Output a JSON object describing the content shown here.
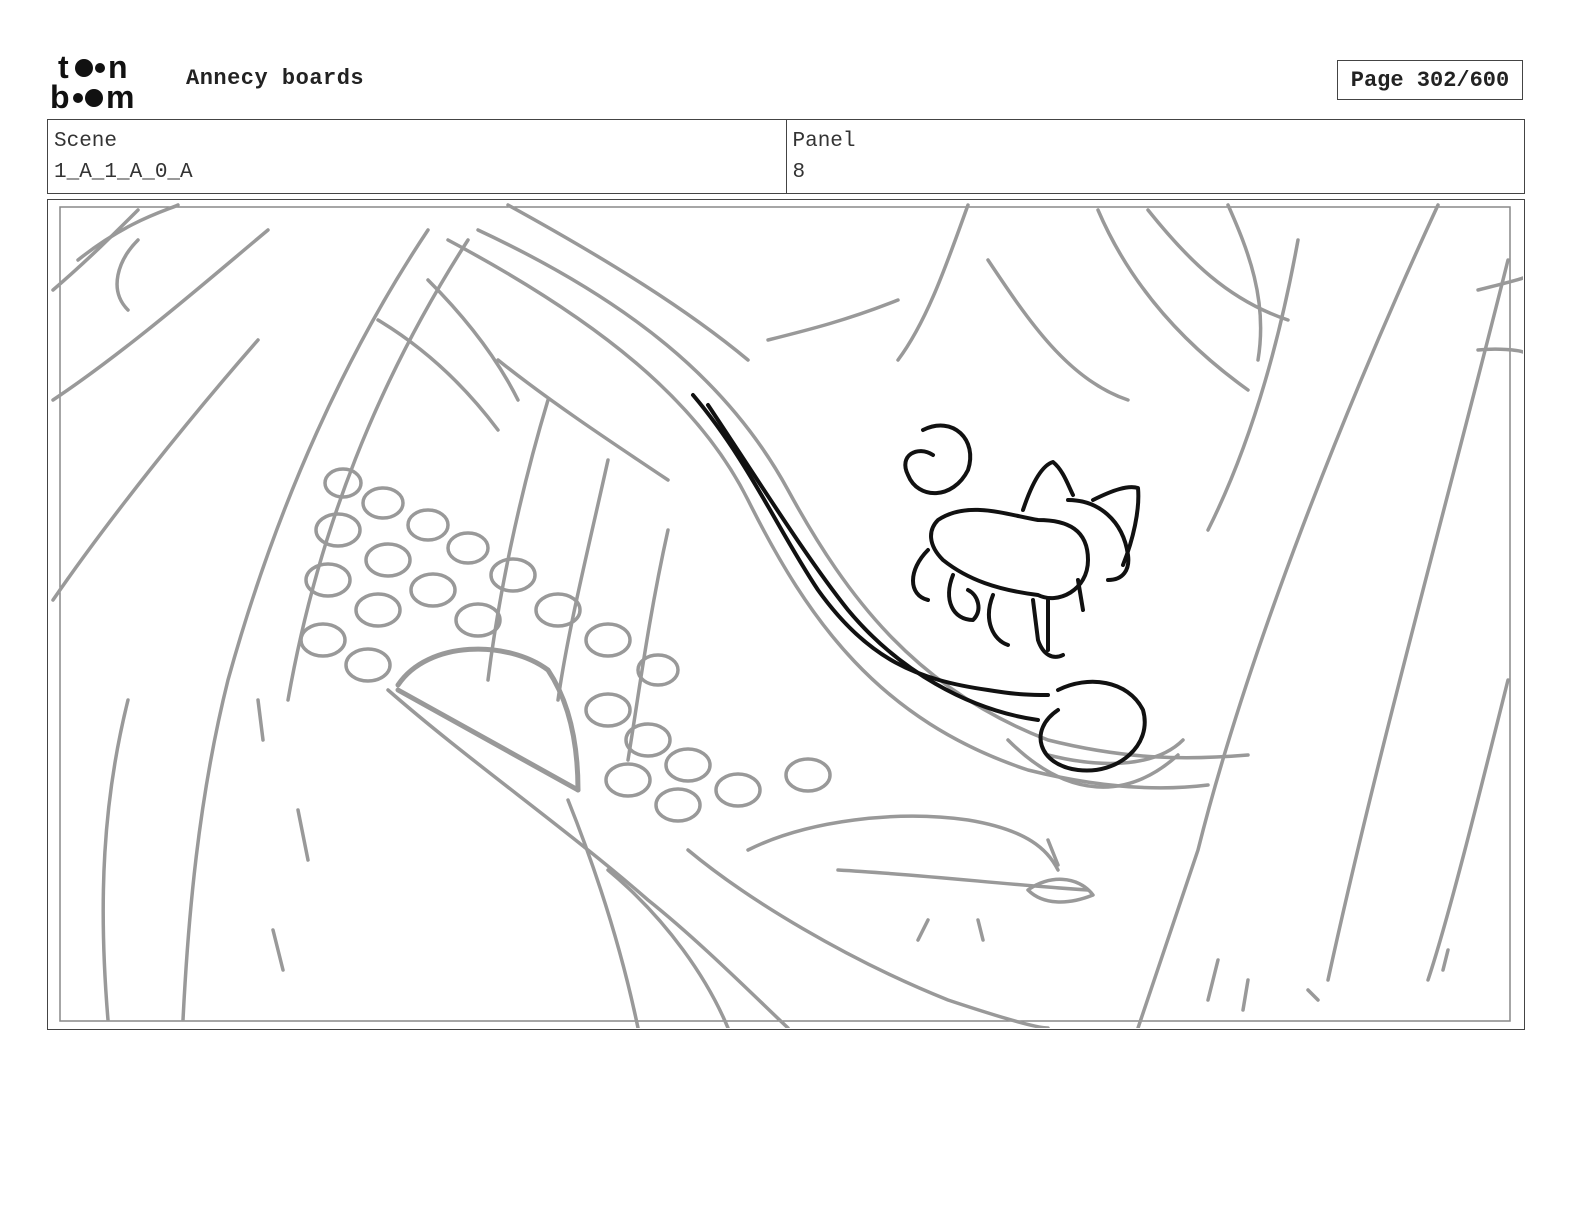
{
  "header": {
    "logo_text": "toon boom",
    "title": "Annecy boards",
    "page_label": "Page 302/600"
  },
  "info": {
    "scene_label": "Scene",
    "scene_value": "1_A_1_A_0_A",
    "panel_label": "Panel",
    "panel_value": "8"
  },
  "colors": {
    "sketch_gray": "#999999",
    "character_ink": "#111111",
    "border": "#444444"
  }
}
